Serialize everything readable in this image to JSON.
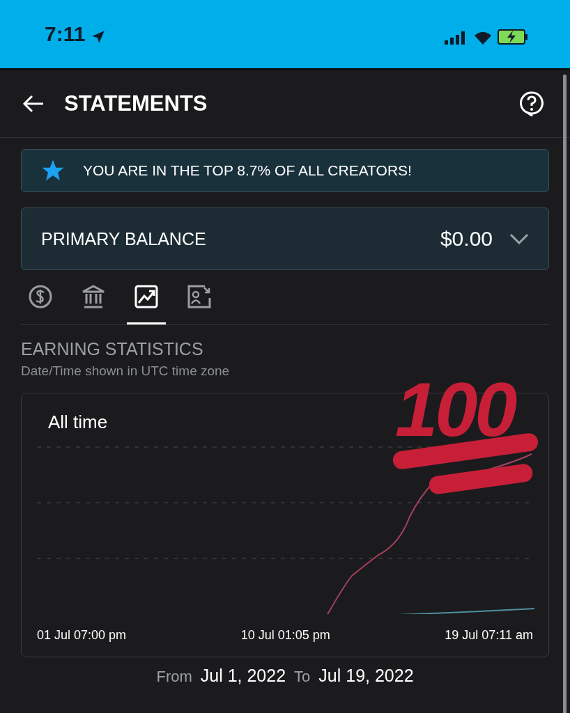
{
  "status_bar": {
    "time": "7:11"
  },
  "header": {
    "title": "STATEMENTS"
  },
  "banner": {
    "text": "YOU ARE IN THE TOP 8.7% OF ALL CREATORS!"
  },
  "balance": {
    "label": "PRIMARY BALANCE",
    "amount": "$0.00",
    "expanded": false
  },
  "tabs": [
    {
      "kind": "dollar",
      "selected": false
    },
    {
      "kind": "bank",
      "selected": false
    },
    {
      "kind": "chart",
      "selected": true
    },
    {
      "kind": "statement",
      "selected": false
    }
  ],
  "section": {
    "title": "EARNING STATISTICS",
    "subtitle": "Date/Time shown in UTC time zone"
  },
  "chart_card": {
    "period": "All time",
    "x_labels": [
      "01 Jul 07:00 pm",
      "10 Jul 01:05 pm",
      "19 Jul 07:11 am"
    ]
  },
  "sticker": {
    "text": "100"
  },
  "range": {
    "from_label": "From",
    "from": "Jul 1, 2022",
    "to_label": "To",
    "to": "Jul 19, 2022"
  }
}
